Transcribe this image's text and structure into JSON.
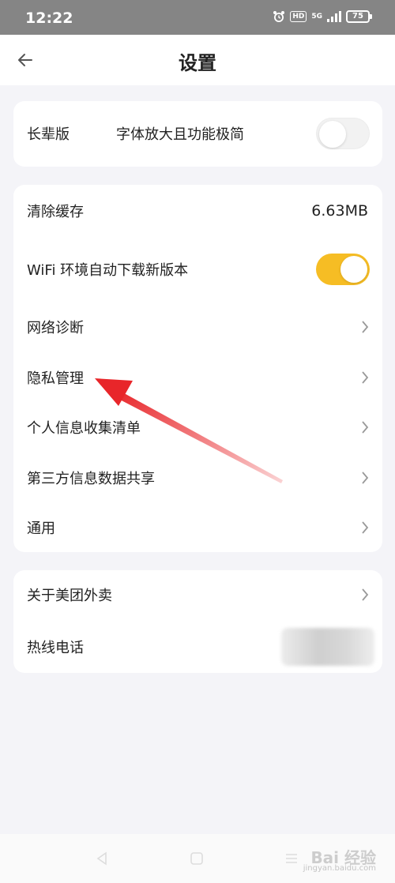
{
  "status_bar": {
    "time": "12:22",
    "hd_label": "HD",
    "network_label": "5G",
    "battery": "75"
  },
  "header": {
    "title": "设置"
  },
  "card1": {
    "elder_mode": {
      "label": "长辈版",
      "description": "字体放大且功能极简",
      "enabled": false
    }
  },
  "card2": {
    "items": [
      {
        "label": "清除缓存",
        "value": "6.63MB"
      },
      {
        "label": "WiFi 环境自动下载新版本",
        "enabled": true
      },
      {
        "label": "网络诊断"
      },
      {
        "label": "隐私管理"
      },
      {
        "label": "个人信息收集清单"
      },
      {
        "label": "第三方信息数据共享"
      },
      {
        "label": "通用"
      }
    ]
  },
  "card3": {
    "items": [
      {
        "label": "关于美团外卖"
      },
      {
        "label": "热线电话"
      }
    ]
  },
  "watermark": {
    "text": "Bai 经验",
    "sub": "jingyan.baidu.com"
  },
  "colors": {
    "accent": "#f6bd24",
    "annotation_arrow": "#e8262a",
    "background": "#f4f4f8"
  }
}
